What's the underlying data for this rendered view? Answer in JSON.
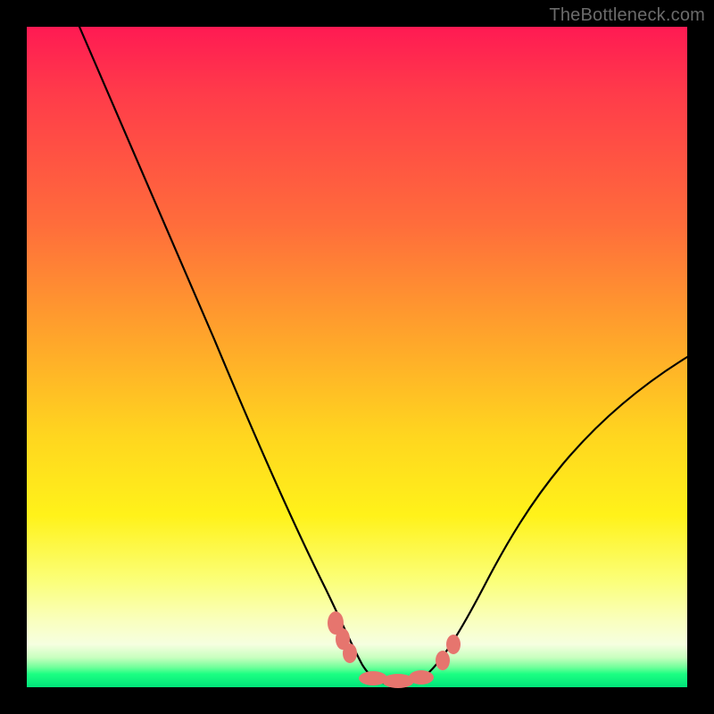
{
  "watermark": "TheBottleneck.com",
  "chart_data": {
    "type": "line",
    "title": "",
    "xlabel": "",
    "ylabel": "",
    "xlim": [
      0,
      100
    ],
    "ylim": [
      0,
      100
    ],
    "background_gradient": [
      "#ff1a53",
      "#ff6d3b",
      "#ffd61f",
      "#fbff7a",
      "#00e47a"
    ],
    "series": [
      {
        "name": "bottleneck-curve",
        "x": [
          8,
          12,
          16,
          20,
          24,
          28,
          32,
          36,
          40,
          44,
          47,
          49,
          51,
          53,
          55,
          58,
          62,
          66,
          70,
          76,
          82,
          88,
          94,
          100
        ],
        "y": [
          100,
          90,
          80,
          70,
          60,
          50,
          41,
          32,
          23.5,
          15.5,
          9.5,
          5.5,
          3,
          1.6,
          1,
          1.2,
          3,
          6.5,
          11,
          18.5,
          26.5,
          34.5,
          42.5,
          50
        ]
      }
    ],
    "markers": {
      "name": "highlight-points",
      "color": "#e6756e",
      "points": [
        {
          "x": 47,
          "y": 9.5
        },
        {
          "x": 48.2,
          "y": 7
        },
        {
          "x": 49.5,
          "y": 4.8
        },
        {
          "x": 52,
          "y": 1.8
        },
        {
          "x": 55,
          "y": 1
        },
        {
          "x": 58,
          "y": 1.2
        },
        {
          "x": 60.5,
          "y": 2.2
        },
        {
          "x": 63.5,
          "y": 4.5
        },
        {
          "x": 65,
          "y": 6
        }
      ]
    }
  }
}
